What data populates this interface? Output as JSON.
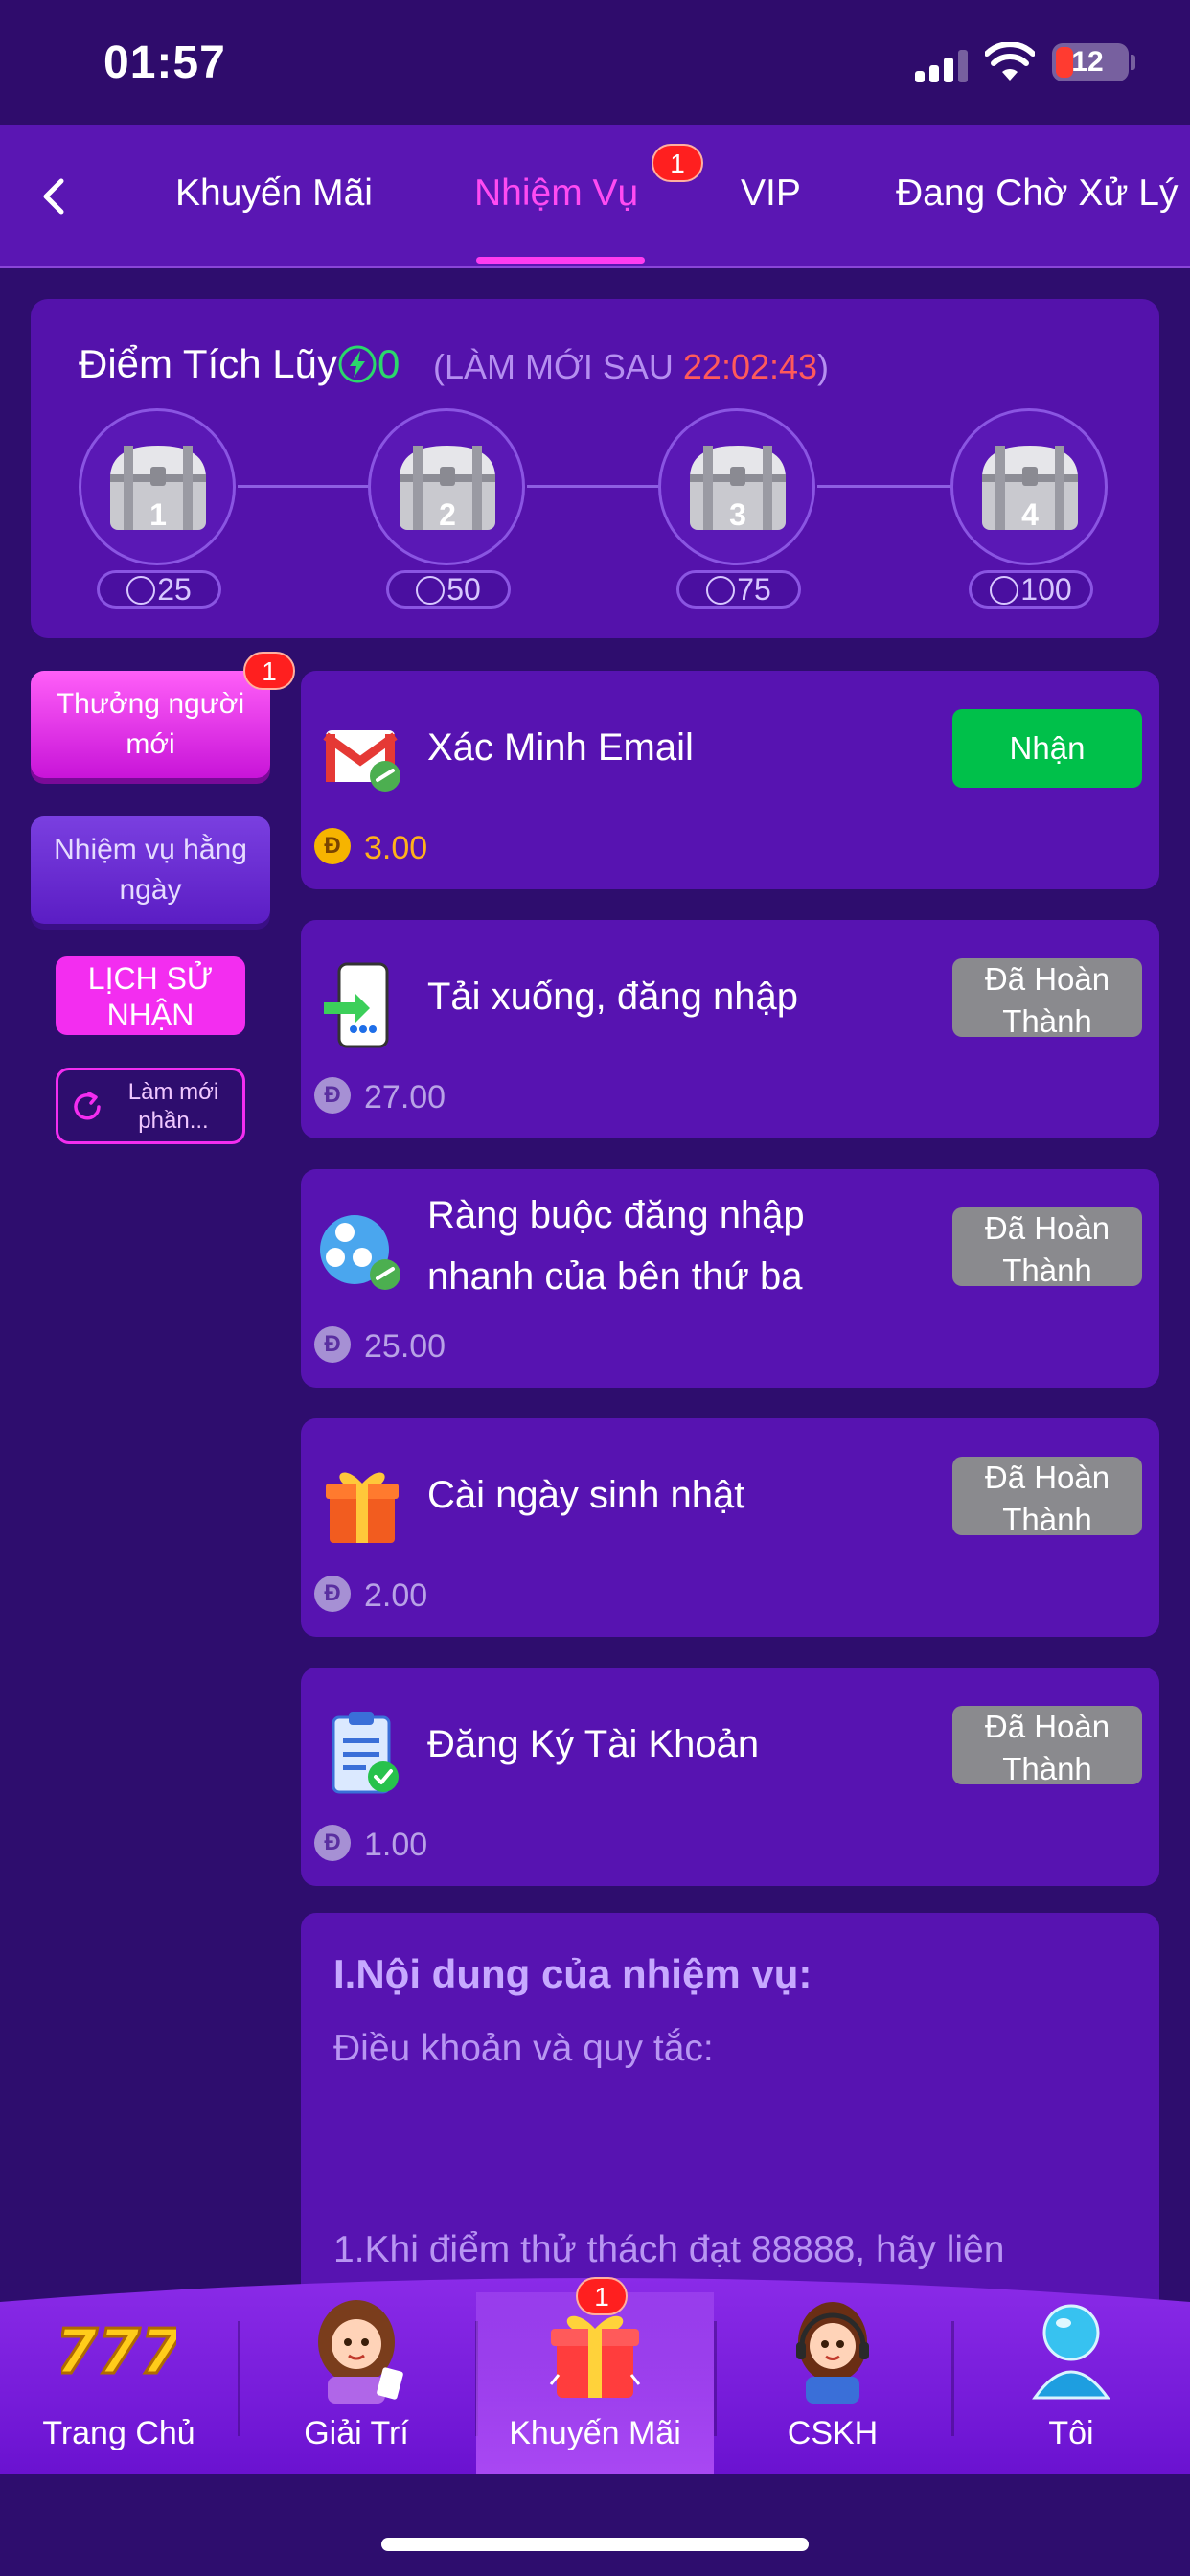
{
  "status_bar": {
    "time": "01:57",
    "battery": "12"
  },
  "tabs": [
    {
      "label": "Khuyến Mãi"
    },
    {
      "label": "Nhiệm Vụ",
      "badge": "1"
    },
    {
      "label": "VIP"
    },
    {
      "label": "Đang Chờ Xử Lý"
    }
  ],
  "points": {
    "title": "Điểm Tích Lũy",
    "value": "0",
    "refresh_prefix": "(LÀM MỚI SAU ",
    "refresh_time": "22:02:43",
    "refresh_suffix": ")",
    "chests": [
      {
        "number": "1",
        "cost": "25"
      },
      {
        "number": "2",
        "cost": "50"
      },
      {
        "number": "3",
        "cost": "75"
      },
      {
        "number": "4",
        "cost": "100"
      }
    ]
  },
  "sidebar": {
    "newbie": {
      "label": "Thưởng người mới",
      "badge": "1"
    },
    "daily": {
      "label": "Nhiệm vụ hằng ngày"
    },
    "history": {
      "label": "LỊCH SỬ NHẬN"
    },
    "refresh": {
      "label": "Làm mới phần..."
    }
  },
  "tasks": [
    {
      "title": "Xác Minh Email",
      "button": "Nhận",
      "reward": "3.00",
      "coin": "Đ",
      "icon": "email-link-icon"
    },
    {
      "title": "Tải xuống, đăng nhập",
      "button": "Đã Hoàn Thành",
      "reward": "27.00",
      "coin": "Đ",
      "icon": "phone-login-icon"
    },
    {
      "title": "Ràng buộc đăng nhập nhanh của bên thứ ba",
      "button": "Đã Hoàn Thành",
      "reward": "25.00",
      "coin": "Đ",
      "icon": "social-link-icon"
    },
    {
      "title": "Cài ngày sinh nhật",
      "button": "Đã Hoàn Thành",
      "reward": "2.00",
      "coin": "Đ",
      "icon": "gift-box-icon"
    },
    {
      "title": "Đăng Ký Tài Khoản",
      "button": "Đã Hoàn Thành",
      "reward": "1.00",
      "coin": "Đ",
      "icon": "clipboard-check-icon"
    }
  ],
  "rules": {
    "heading": "I.Nội dung của nhiệm vụ:",
    "subheading": "Điều khoản và quy tắc:",
    "line1": "1.Khi điểm thử thách đạt 88888, hãy liên"
  },
  "bottom_nav": [
    {
      "label": "Trang Chủ",
      "icon": "slot-777-icon"
    },
    {
      "label": "Giải Trí",
      "icon": "girl-cards-icon"
    },
    {
      "label": "Khuyến Mãi",
      "icon": "gift-icon",
      "badge": "1"
    },
    {
      "label": "CSKH",
      "icon": "support-agent-icon"
    },
    {
      "label": "Tôi",
      "icon": "user-icon"
    }
  ],
  "colors": {
    "background": "#2e0d6e",
    "accent": "#ff3cf0",
    "claim": "#00c04a",
    "done": "#8a8a8e",
    "gold": "#ffb21a",
    "timer": "#ff5a5a",
    "points": "#2bd86b"
  }
}
